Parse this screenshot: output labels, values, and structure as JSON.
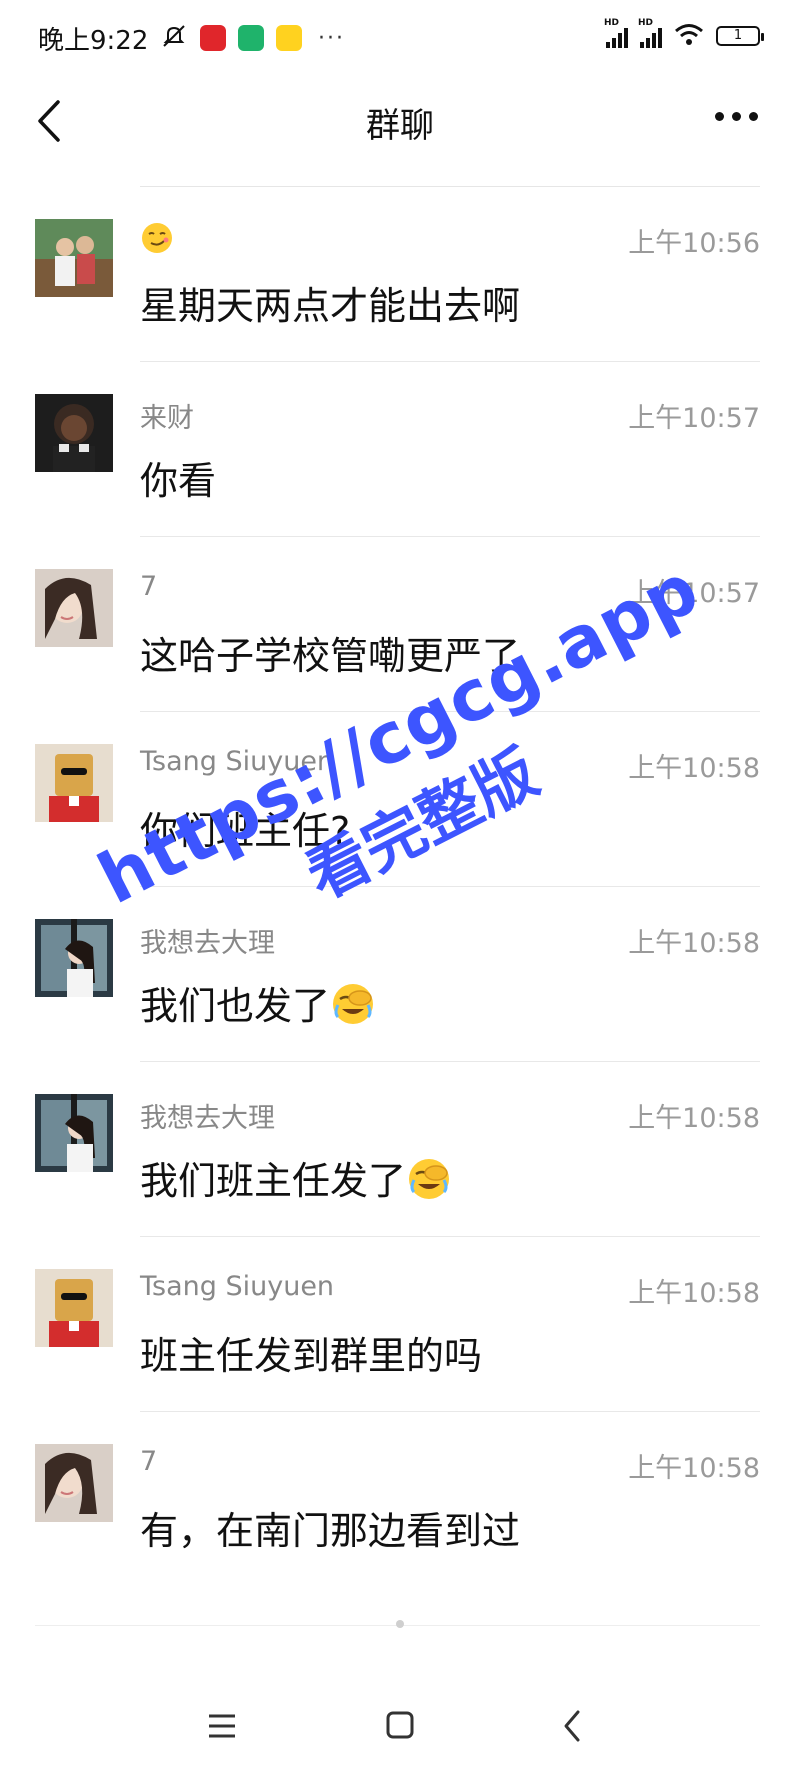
{
  "status_bar": {
    "time": "晚上9:22",
    "more": "···",
    "battery": "1",
    "signal_label": "HD"
  },
  "header": {
    "title": "群聊"
  },
  "messages": [
    {
      "sender": "",
      "sender_emoji": "smirk-emoji",
      "time": "上午10:56",
      "text": "星期天两点才能出去啊",
      "trailing_emoji": ""
    },
    {
      "sender": "来财",
      "time": "上午10:57",
      "text": "你看",
      "trailing_emoji": ""
    },
    {
      "sender": "7",
      "time": "上午10:57",
      "text": "这哈子学校管嘞更严了",
      "trailing_emoji": ""
    },
    {
      "sender": "Tsang Siuyuen",
      "time": "上午10:58",
      "text": "你们班主任?",
      "trailing_emoji": ""
    },
    {
      "sender": "我想去大理",
      "time": "上午10:58",
      "text": "我们也发了",
      "trailing_emoji": "facepalm-laugh-emoji"
    },
    {
      "sender": "我想去大理",
      "time": "上午10:58",
      "text": "我们班主任发了",
      "trailing_emoji": "facepalm-laugh-emoji"
    },
    {
      "sender": "Tsang Siuyuen",
      "time": "上午10:58",
      "text": "班主任发到群里的吗",
      "trailing_emoji": ""
    },
    {
      "sender": "7",
      "time": "上午10:58",
      "text": "有，在南门那边看到过",
      "trailing_emoji": ""
    }
  ],
  "watermark": {
    "url": "https://cgcg.app",
    "subtitle": "看完整版",
    "color": "#3d55ff"
  },
  "colors": {
    "meta_text": "#9a9a9a",
    "divider": "#e8e8e8"
  }
}
